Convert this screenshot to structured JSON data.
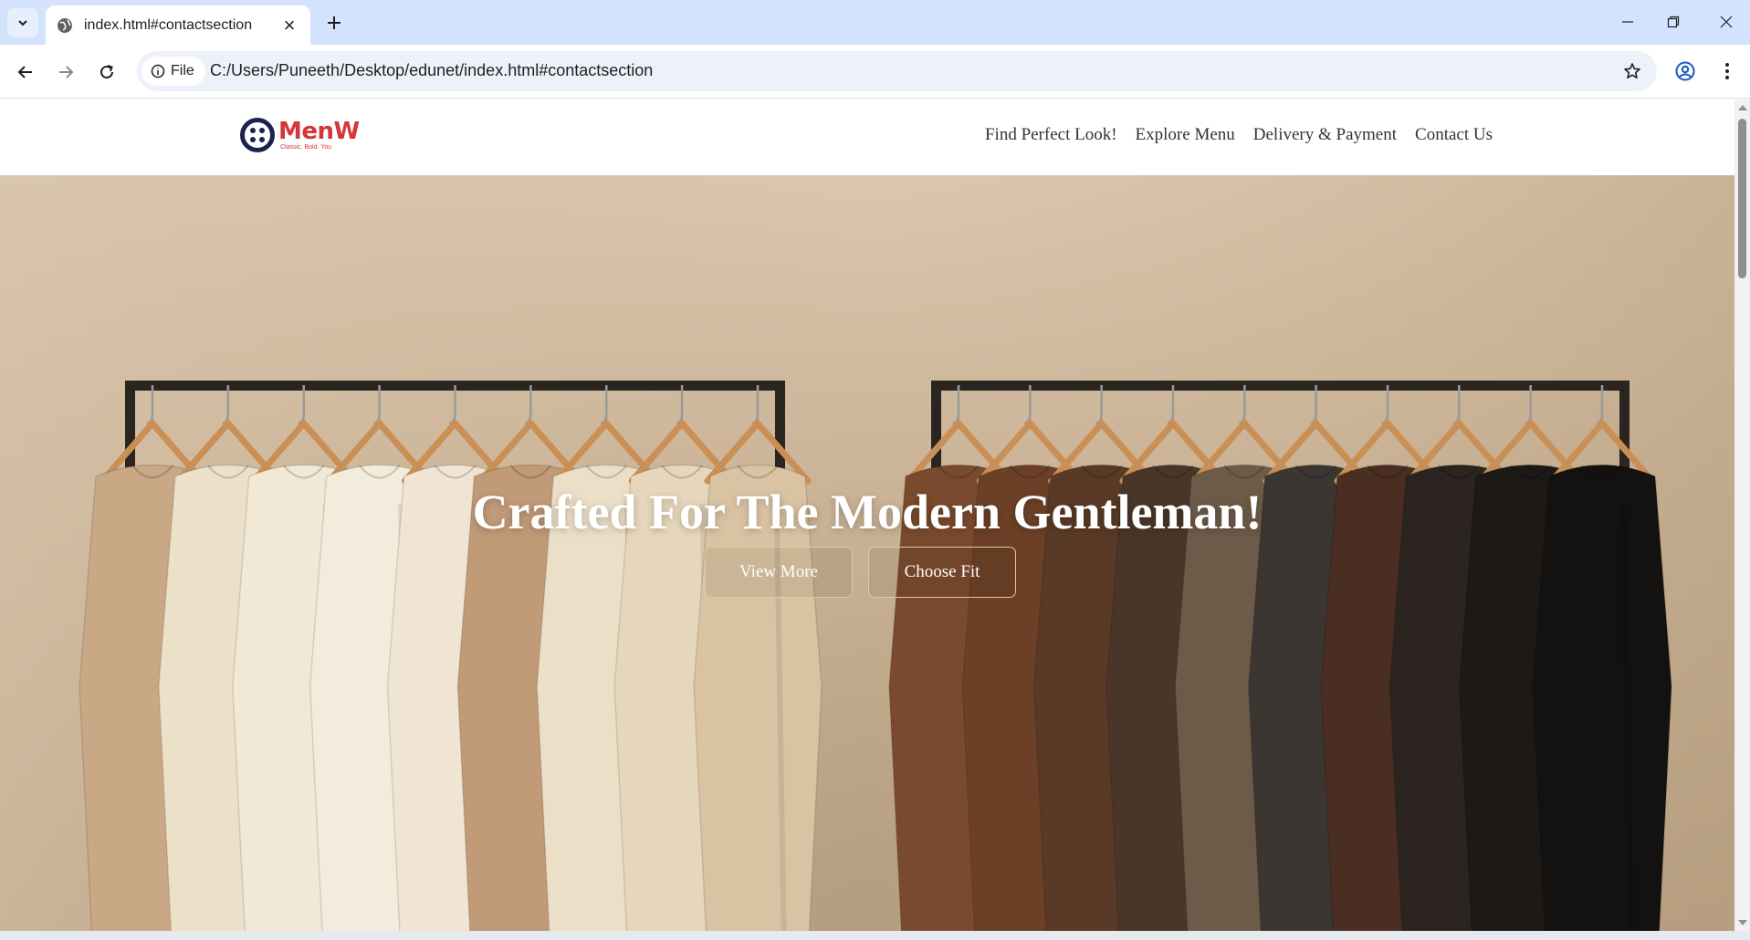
{
  "browser": {
    "tab_title": "index.html#contactsection",
    "url_chip": "File",
    "url": "C:/Users/Puneeth/Desktop/edunet/index.html#contactsection",
    "icons": [
      "tab-search-icon",
      "globe-icon",
      "close-icon",
      "plus-icon",
      "minimize-icon",
      "restore-icon",
      "window-close-icon",
      "back-arrow-icon",
      "forward-arrow-icon",
      "reload-icon",
      "info-icon",
      "star-icon",
      "profile-icon",
      "more-vert-icon"
    ]
  },
  "site": {
    "logo": {
      "name": "MenW",
      "tagline": "Classic. Bold. You"
    },
    "nav": [
      {
        "label": "Find Perfect Look!"
      },
      {
        "label": "Explore Menu"
      },
      {
        "label": "Delivery & Payment"
      },
      {
        "label": "Contact Us"
      }
    ],
    "hero": {
      "title": "Crafted For The Modern Gentleman!",
      "buttons": [
        {
          "label": "View More"
        },
        {
          "label": "Choose Fit"
        }
      ]
    }
  },
  "colors": {
    "tabbar_bg": "#d3e3fd",
    "logo_red": "#d4363a",
    "logo_navy": "#1b2250",
    "button_border": "#e4c89a"
  }
}
